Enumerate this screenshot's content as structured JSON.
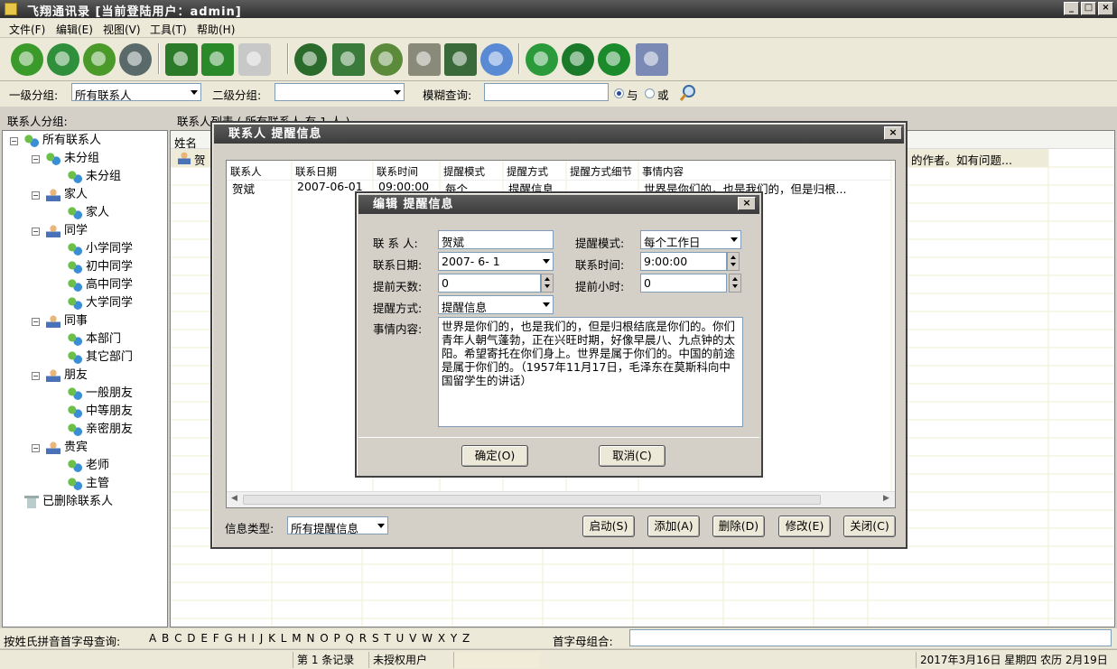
{
  "window": {
    "title": "飞翔通讯录  [当前登陆用户：admin]",
    "min": "_",
    "max": "□",
    "close": "×"
  },
  "menu": [
    "文件(F)",
    "编辑(E)",
    "视图(V)",
    "工具(T)",
    "帮助(H)"
  ],
  "toolbar": {
    "icons": [
      "add-contact-icon",
      "edit-contact-icon",
      "delete-contact-icon",
      "refresh-icon",
      "import-icon",
      "export-icon",
      "print-icon",
      "search-icon",
      "calendar-icon",
      "reminder-clock-icon",
      "notes-icon",
      "settings-icon",
      "statistics-icon",
      "backup-icon",
      "help-icon",
      "info-icon",
      "exit-icon"
    ]
  },
  "filter": {
    "group1_label": "一级分组:",
    "group1_value": "所有联系人",
    "group2_label": "二级分组:",
    "group2_value": "",
    "fuzzy_label": "模糊查询:",
    "fuzzy_value": "",
    "and_label": "与",
    "or_label": "或"
  },
  "left": {
    "header": "联系人分组:",
    "tree": [
      {
        "label": "所有联系人",
        "level": 0,
        "icon": "group-icon",
        "expand": "−"
      },
      {
        "label": "未分组",
        "level": 1,
        "icon": "folder-icon",
        "expand": "−"
      },
      {
        "label": "未分组",
        "level": 2,
        "icon": "group-icon"
      },
      {
        "label": "家人",
        "level": 1,
        "icon": "person-icon",
        "expand": "−"
      },
      {
        "label": "家人",
        "level": 2,
        "icon": "group-icon"
      },
      {
        "label": "同学",
        "level": 1,
        "icon": "person-icon",
        "expand": "−"
      },
      {
        "label": "小学同学",
        "level": 2,
        "icon": "group-icon"
      },
      {
        "label": "初中同学",
        "level": 2,
        "icon": "group-icon"
      },
      {
        "label": "高中同学",
        "level": 2,
        "icon": "group-icon"
      },
      {
        "label": "大学同学",
        "level": 2,
        "icon": "group-icon"
      },
      {
        "label": "同事",
        "level": 1,
        "icon": "person-icon",
        "expand": "−"
      },
      {
        "label": "本部门",
        "level": 2,
        "icon": "group-icon"
      },
      {
        "label": "其它部门",
        "level": 2,
        "icon": "group-icon"
      },
      {
        "label": "朋友",
        "level": 1,
        "icon": "person-icon",
        "expand": "−"
      },
      {
        "label": "一般朋友",
        "level": 2,
        "icon": "group-icon"
      },
      {
        "label": "中等朋友",
        "level": 2,
        "icon": "group-icon"
      },
      {
        "label": "亲密朋友",
        "level": 2,
        "icon": "group-icon"
      },
      {
        "label": "贵宾",
        "level": 1,
        "icon": "person-icon",
        "expand": "−"
      },
      {
        "label": "老师",
        "level": 2,
        "icon": "group-icon"
      },
      {
        "label": "主管",
        "level": 2,
        "icon": "group-icon"
      },
      {
        "label": "已删除联系人",
        "level": 0,
        "icon": "trash-icon"
      }
    ]
  },
  "main": {
    "header": "联系人列表 ( 所有联系人 有 1 人 )",
    "col_name": "姓名",
    "row_name": "贺",
    "row_tail": "的作者。如有问题..."
  },
  "bottom": {
    "alpha_label": "按姓氏拼音首字母查询:",
    "letters": "A B C D E F G H I J K L M N O P Q R S T U V W X Y Z",
    "combo_label": "首字母组合:"
  },
  "status": {
    "records": "第 1 条记录",
    "license": "未授权用户",
    "date": "2017年3月16日 星期四 农历 2月19日"
  },
  "dialog1": {
    "title": "联系人 提醒信息",
    "close": "×",
    "columns": [
      "联系人",
      "联系日期",
      "联系时间",
      "提醒模式",
      "提醒方式",
      "提醒方式细节",
      "事情内容"
    ],
    "row": [
      "贺斌",
      "2007-06-01",
      "09:00:00",
      "每个...",
      "提醒信息",
      "",
      "世界是你们的，也是我们的，但是归根..."
    ],
    "type_label": "信息类型:",
    "type_value": "所有提醒信息",
    "buttons": [
      "启动(S)",
      "添加(A)",
      "删除(D)",
      "修改(E)",
      "关闭(C)"
    ]
  },
  "dialog2": {
    "title": "编辑 提醒信息",
    "close": "×",
    "contact_label": "联 系 人:",
    "contact_value": "贺斌",
    "mode_label": "提醒模式:",
    "mode_value": "每个工作日",
    "date_label": "联系日期:",
    "date_value": "2007- 6- 1",
    "time_label": "联系时间:",
    "time_value": "9:00:00",
    "days_label": "提前天数:",
    "days_value": "0",
    "hours_label": "提前小时:",
    "hours_value": "0",
    "method_label": "提醒方式:",
    "method_value": "提醒信息",
    "content_label": "事情内容:",
    "content_value": "世界是你们的，也是我们的，但是归根结底是你们的。你们青年人朝气蓬勃，正在兴旺时期，好像早晨八、九点钟的太阳。希望寄托在你们身上。世界是属于你们的。中国的前途是属于你们的。（1957年11月17日，毛泽东在莫斯科向中国留学生的讲话）",
    "ok": "确定(O)",
    "cancel": "取消(C)"
  }
}
